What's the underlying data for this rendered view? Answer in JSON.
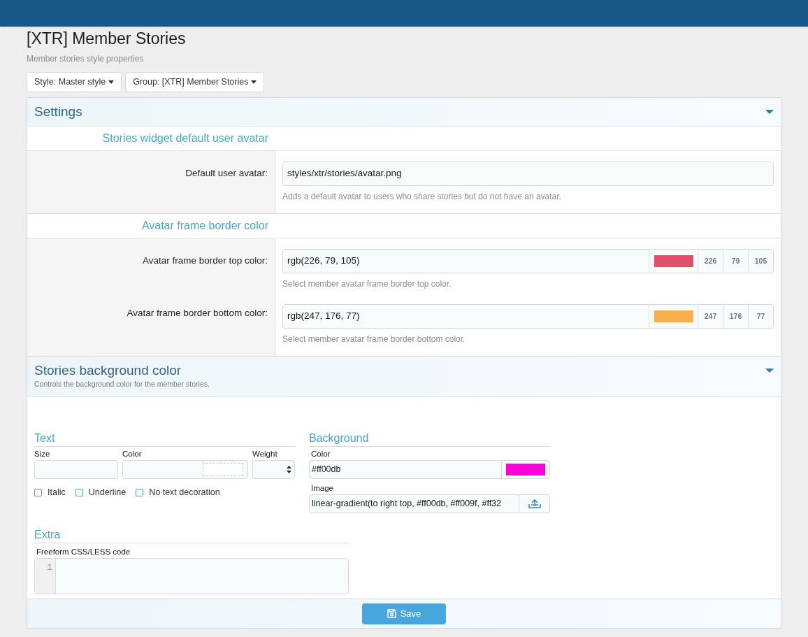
{
  "title": "[XTR] Member Stories",
  "description": "Member stories style properties",
  "filters": [
    {
      "label": "Style: Master style"
    },
    {
      "label": "Group: [XTR] Member Stories"
    }
  ],
  "settings": {
    "title": "Settings",
    "expanded": true,
    "groups": [
      {
        "heading": "Stories widget default user avatar",
        "rows": [
          {
            "kind": "text",
            "label": "Default user avatar:",
            "value": "styles/xtr/stories/avatar.png",
            "hint": "Adds a default avatar to users who share stories but do not have an avatar."
          }
        ]
      },
      {
        "heading": "Avatar frame border color",
        "rows": [
          {
            "kind": "color",
            "label": "Avatar frame border top color:",
            "value": "rgb(226, 79, 105)",
            "color": "#e24f69",
            "channels": [
              "226",
              "79",
              "105"
            ],
            "hint": "Select member avatar frame border top color."
          },
          {
            "kind": "color",
            "label": "Avatar frame border bottom color:",
            "value": "rgb(247, 176, 77)",
            "color": "#f7b04d",
            "channels": [
              "247",
              "176",
              "77"
            ],
            "hint": "Select member avatar frame border bottom color."
          }
        ]
      }
    ]
  },
  "background_panel": {
    "title": "Stories background color",
    "description": "Controls the background color for the member stories.",
    "expanded": true,
    "text": {
      "heading": "Text",
      "size_label": "Size",
      "color_label": "Color",
      "weight_label": "Weight",
      "checkboxes": [
        {
          "label": "Italic",
          "checked": false
        },
        {
          "label": "Underline",
          "checked": false
        },
        {
          "label": "No text decoration",
          "checked": false
        }
      ]
    },
    "background": {
      "heading": "Background",
      "color_label": "Color",
      "color_value": "#ff00db",
      "color": "#ff00db",
      "image_label": "Image",
      "image_value": "linear-gradient(to right top, #ff00db, #ff009f, #ff32"
    },
    "extra": {
      "heading": "Extra",
      "code_label": "Freeform CSS/LESS code",
      "line_numbers": [
        "1"
      ]
    }
  },
  "save_button": {
    "label": "Save"
  }
}
